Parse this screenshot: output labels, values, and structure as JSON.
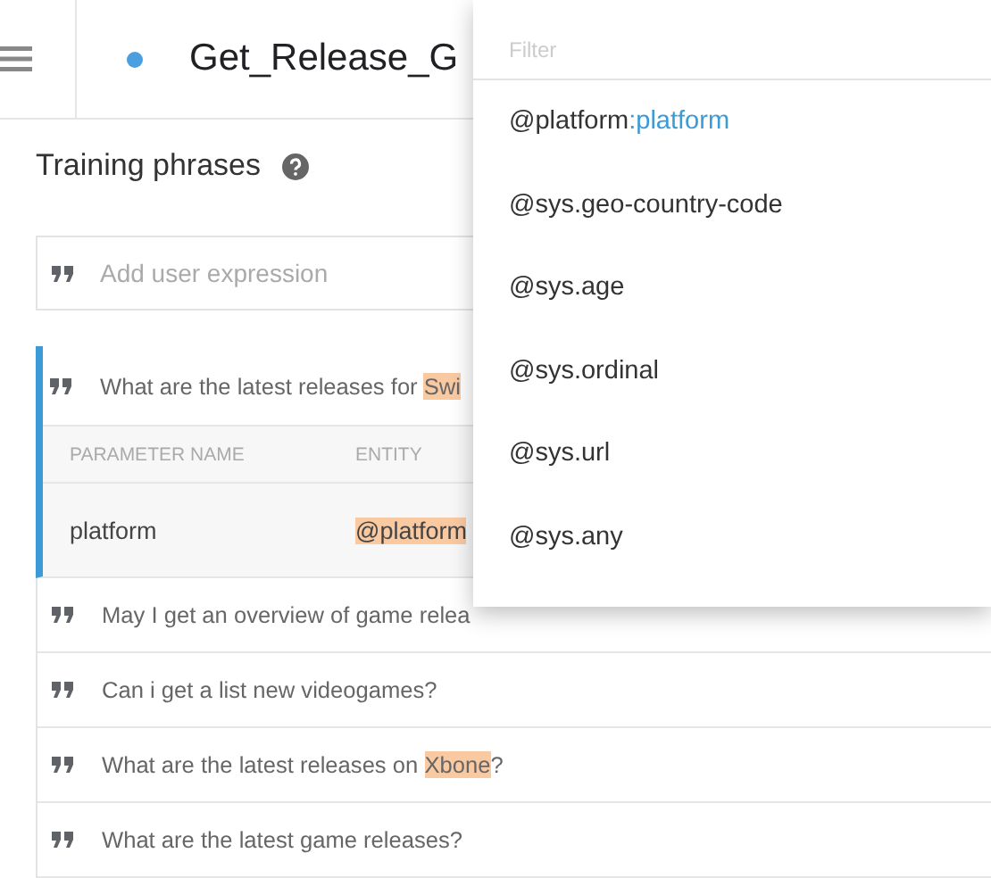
{
  "header": {
    "title": "Get_Release_G"
  },
  "section": {
    "title": "Training phrases"
  },
  "expression_field": {
    "placeholder": "Add user expression"
  },
  "phrases": [
    {
      "selected": true,
      "parts": [
        {
          "text": "What are the latest releases for ",
          "kind": "plain"
        },
        {
          "text": "Swi",
          "kind": "annotated"
        }
      ],
      "parameters": {
        "columns": [
          "PARAMETER NAME",
          "ENTITY"
        ],
        "rows": [
          {
            "name": "platform",
            "entity": "@platform"
          }
        ]
      }
    },
    {
      "selected": false,
      "parts": [
        {
          "text": "May I get an overview of game relea",
          "kind": "plain"
        }
      ]
    },
    {
      "selected": false,
      "parts": [
        {
          "text": "Can i get a list new videogames?",
          "kind": "plain"
        }
      ]
    },
    {
      "selected": false,
      "parts": [
        {
          "text": "What are the latest releases on ",
          "kind": "plain"
        },
        {
          "text": "Xbone",
          "kind": "annotated"
        },
        {
          "text": "?",
          "kind": "plain"
        }
      ]
    },
    {
      "selected": false,
      "parts": [
        {
          "text": "What are the latest game releases?",
          "kind": "plain"
        }
      ]
    }
  ],
  "entity_menu": {
    "filter": {
      "placeholder": "Filter"
    },
    "items": [
      {
        "parts": [
          {
            "text": "@platform",
            "kind": "plain"
          },
          {
            "text": ":platform",
            "kind": "hint"
          }
        ]
      },
      {
        "parts": [
          {
            "text": "@sys.geo-country-code",
            "kind": "plain"
          }
        ]
      },
      {
        "parts": [
          {
            "text": "@sys.age",
            "kind": "plain"
          }
        ]
      },
      {
        "parts": [
          {
            "text": "@sys.ordinal",
            "kind": "plain"
          }
        ]
      },
      {
        "parts": [
          {
            "text": "@sys.url",
            "kind": "plain"
          }
        ]
      },
      {
        "parts": [
          {
            "text": "@sys.any",
            "kind": "plain"
          }
        ]
      }
    ]
  }
}
